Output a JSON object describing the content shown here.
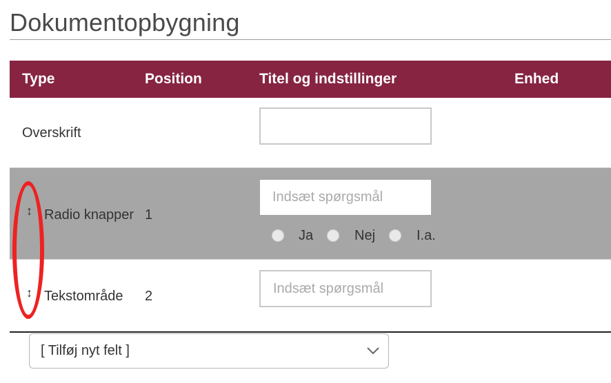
{
  "page": {
    "title": "Dokumentopbygning"
  },
  "table": {
    "headers": {
      "type": "Type",
      "position": "Position",
      "title": "Titel og indstillinger",
      "unit": "Enhed"
    },
    "rows": [
      {
        "type": "Overskrift",
        "position": "",
        "input_value": "",
        "input_placeholder": ""
      },
      {
        "type": "Radio knapper",
        "position": "1",
        "input_value": "",
        "input_placeholder": "Indsæt spørgsmål",
        "radio_options": [
          "Ja",
          "Nej",
          "I.a."
        ]
      },
      {
        "type": "Tekstområde",
        "position": "2",
        "input_value": "",
        "input_placeholder": "Indsæt spørgsmål"
      }
    ],
    "drag_glyph": "↕"
  },
  "add_field": {
    "selected": "[ Tilføj nyt felt ]"
  },
  "colors": {
    "header_bg": "#862442",
    "selected_row_bg": "#a6a6a6",
    "annotation": "#ee2222"
  }
}
